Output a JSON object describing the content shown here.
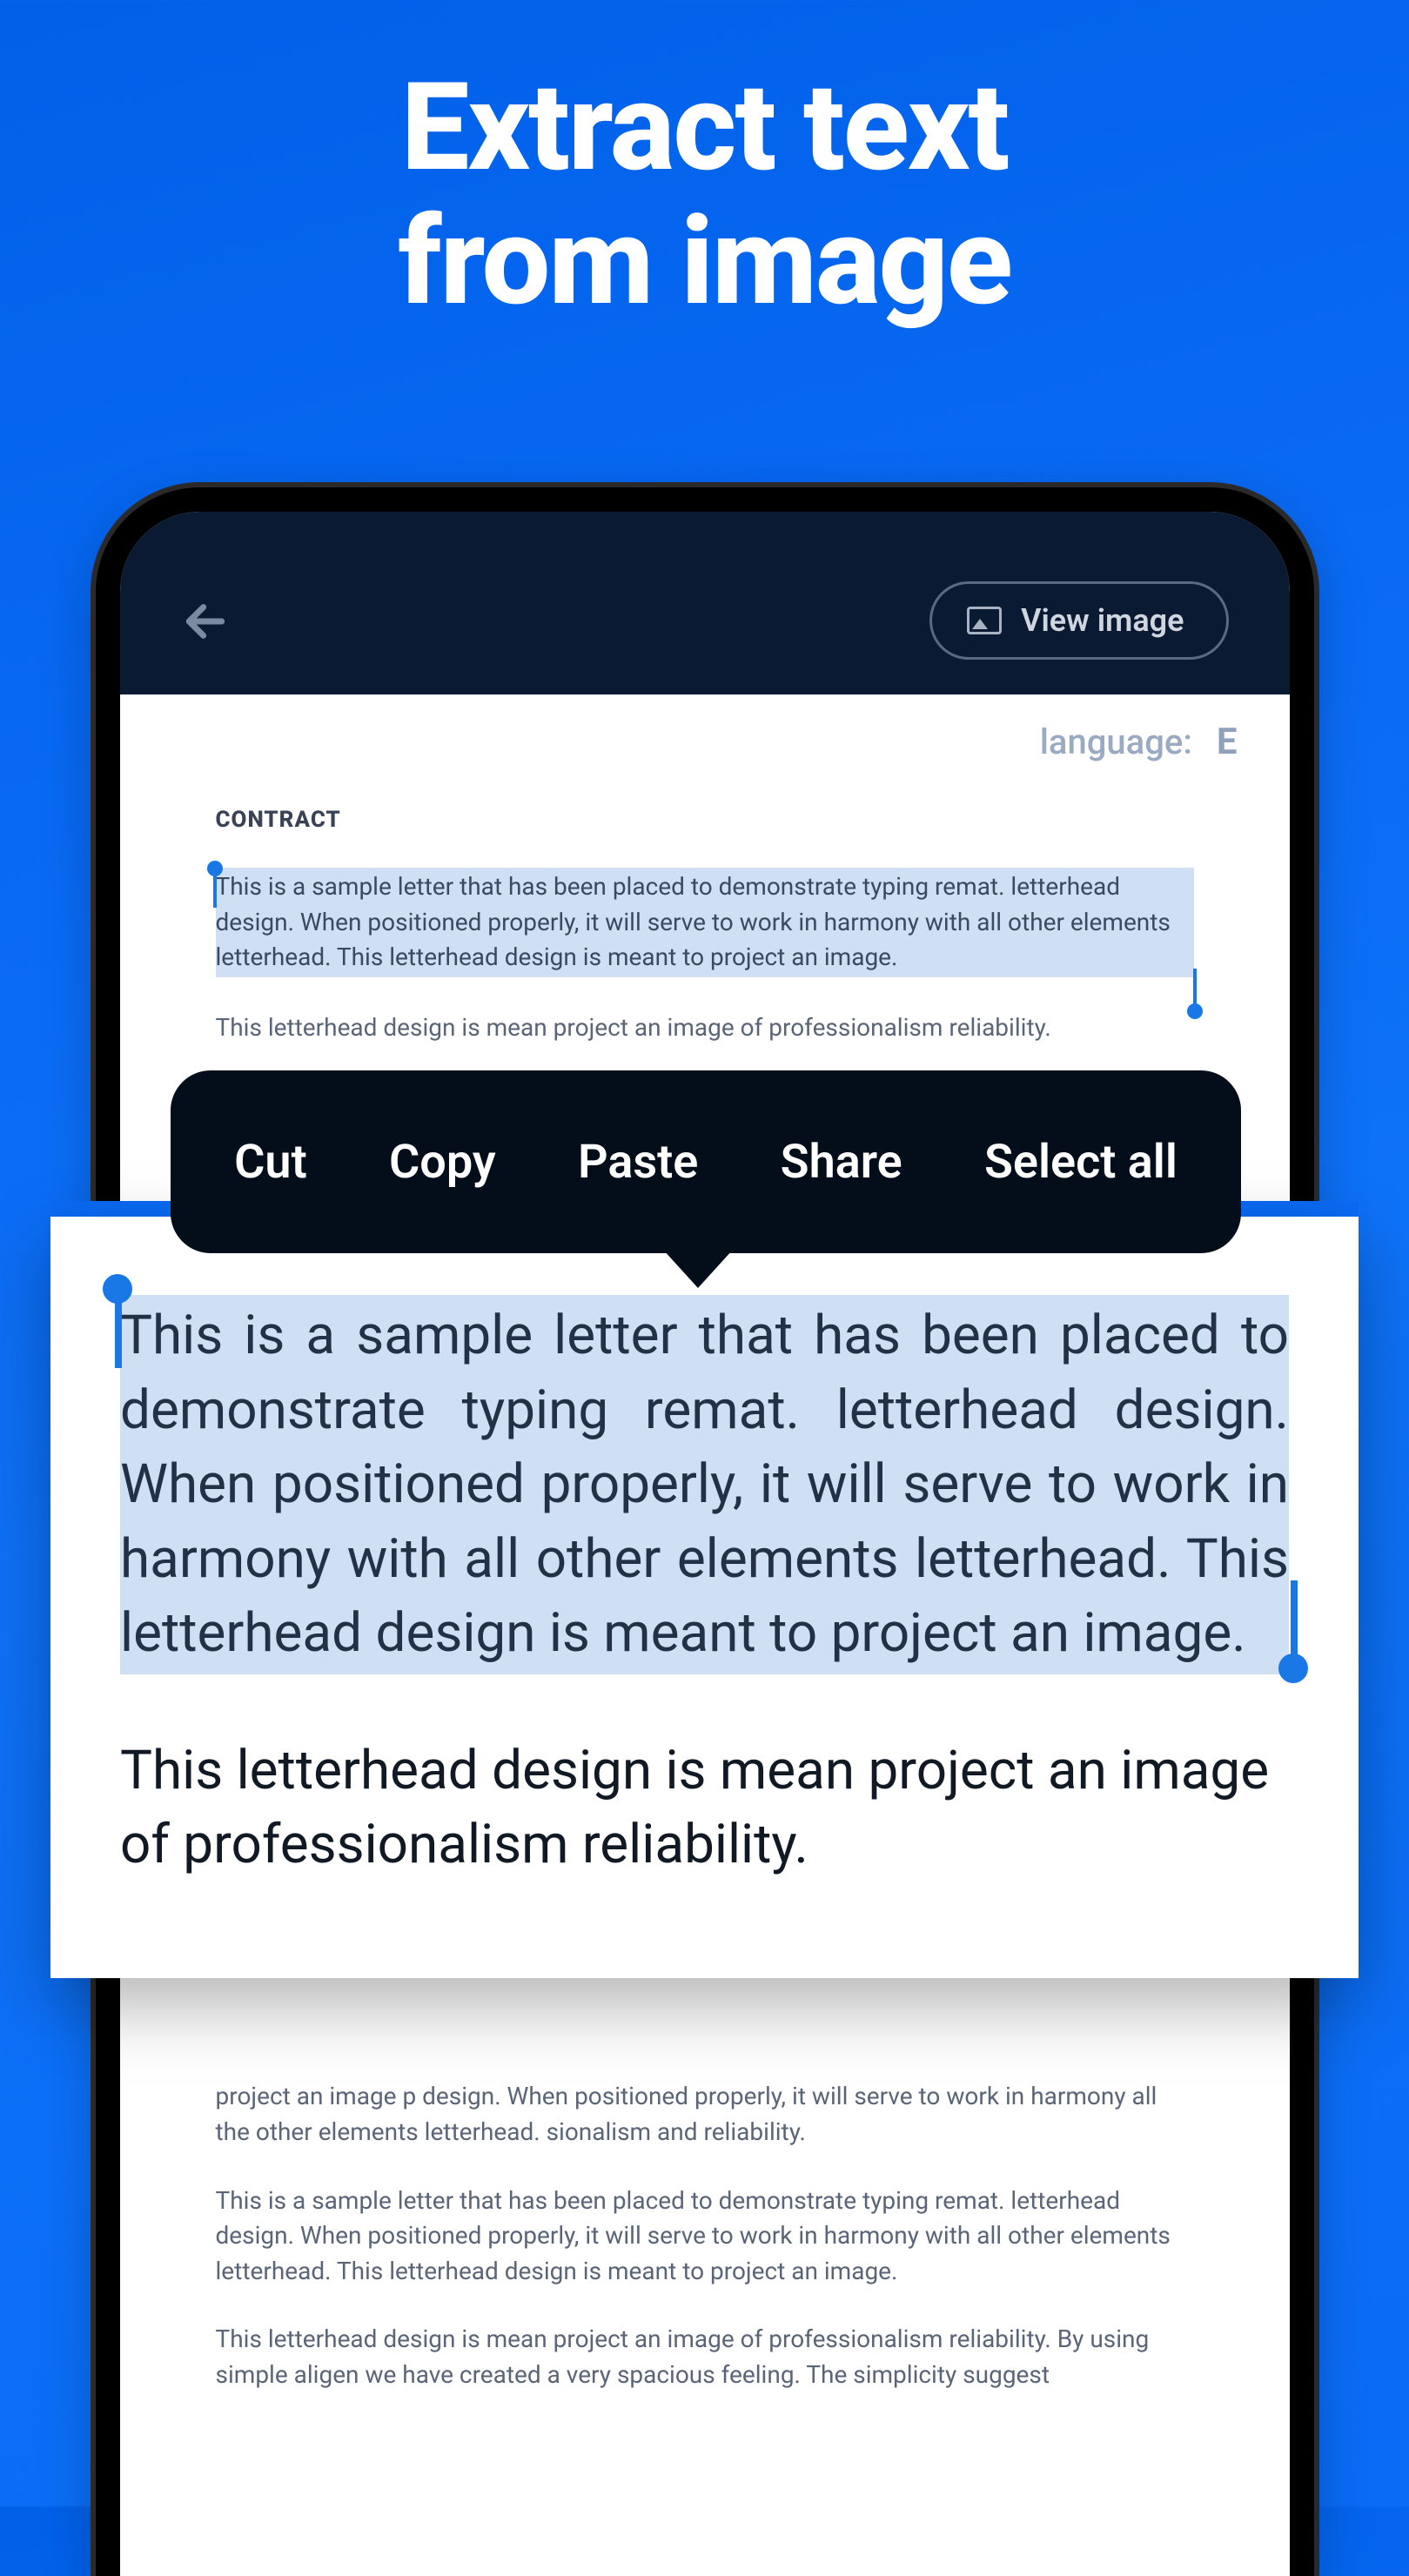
{
  "hero": {
    "line1": "Extract text",
    "line2": "from image"
  },
  "appHeader": {
    "viewImage": "View image"
  },
  "languageRow": {
    "label": "language:",
    "code": "E"
  },
  "document": {
    "heading": "CONTRACT",
    "selected_para": "This is a sample letter that has been placed to demonstrate typing remat. letterhead design. When positioned properly, it will serve to work in harmony with all other elements letterhead. This letterhead design is meant to project an image.",
    "para2_truncated": "This letterhead design is mean project an image of professionalism reliability.",
    "para_back_a": "project an image p design. When positioned properly, it will serve to work in harmony all the other elements letterhead. sionalism and reliability.",
    "para_back_b": "This is a sample letter that has been placed to demonstrate typing remat. letterhead design. When positioned properly, it will serve to work in harmony with all other elements letterhead. This letterhead design is meant to project an image.",
    "para_back_c": "This letterhead design is mean project an image of professionalism reliability. By using simple aligen we have created a very spacious feeling. The simplicity suggest"
  },
  "overlay": {
    "selected_big": "This is a sample letter that has been placed to demonstrate typing remat. letterhead design. When positioned properly, it will serve to work in harmony with all other elements letterhead. This letterhead design is meant to project an image.",
    "para2_big": "This letterhead design is mean project an image of professionalism reliability."
  },
  "contextMenu": {
    "cut": "Cut",
    "copy": "Copy",
    "paste": "Paste",
    "share": "Share",
    "selectAll": "Select all"
  }
}
